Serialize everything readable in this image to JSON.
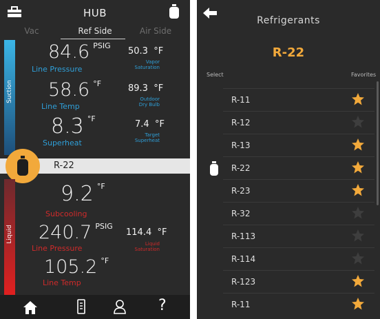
{
  "colors": {
    "accent": "#f2a93b",
    "suction_blue": "#2f9fd8",
    "liquid_red": "#d02a2a",
    "star_on": "#f2a93b",
    "star_off": "#3e3e3e"
  },
  "hub": {
    "title": "HUB",
    "tabs": [
      "Vac",
      "Ref Side",
      "Air Side"
    ],
    "active_tab": "Ref Side",
    "suction_label": "Suction",
    "liquid_label": "Liquid",
    "line_pressure": {
      "value": "84.6",
      "unit": "PSIG",
      "label": "Line Pressure"
    },
    "vapor_saturation": {
      "value": "50.3",
      "unit": "°F",
      "label1": "Vapor",
      "label2": "Saturation"
    },
    "line_temp": {
      "value": "58.6",
      "unit": "°F",
      "label": "Line Temp"
    },
    "outdoor_dry_bulb": {
      "value": "89.3",
      "unit": "°F",
      "label1": "Outdoor",
      "label2": "Dry Bulb"
    },
    "superheat": {
      "value": "8.3",
      "unit": "°F",
      "label": "Superheat"
    },
    "target_superheat": {
      "value": "7.4",
      "unit": "°F",
      "label1": "Target",
      "label2": "Superheat"
    },
    "refrigerant": "R-22",
    "subcooling": {
      "value": "9.2",
      "unit": "°F",
      "label": "Subcooling"
    },
    "liquid_line_pressure": {
      "value": "240.7",
      "unit": "PSIG",
      "label": "Line Pressure"
    },
    "liquid_saturation": {
      "value": "114.4",
      "unit": "°F",
      "label1": "Liquid",
      "label2": "Saturation"
    },
    "liquid_line_temp": {
      "value": "105.2",
      "unit": "°F",
      "label": "Line Temp"
    },
    "nav": {
      "help": "?"
    }
  },
  "refrigerants": {
    "title": "Refrigerants",
    "selected": "R-22",
    "select_label": "Select",
    "favorites_label": "Favorites",
    "items": [
      {
        "name": "R-11",
        "favorite": true
      },
      {
        "name": "R-12",
        "favorite": false
      },
      {
        "name": "R-13",
        "favorite": true
      },
      {
        "name": "R-22",
        "favorite": true
      },
      {
        "name": "R-23",
        "favorite": true
      },
      {
        "name": "R-32",
        "favorite": false
      },
      {
        "name": "R-113",
        "favorite": false
      },
      {
        "name": "R-114",
        "favorite": false
      },
      {
        "name": "R-123",
        "favorite": true
      },
      {
        "name": "R-11",
        "favorite": true
      }
    ]
  }
}
